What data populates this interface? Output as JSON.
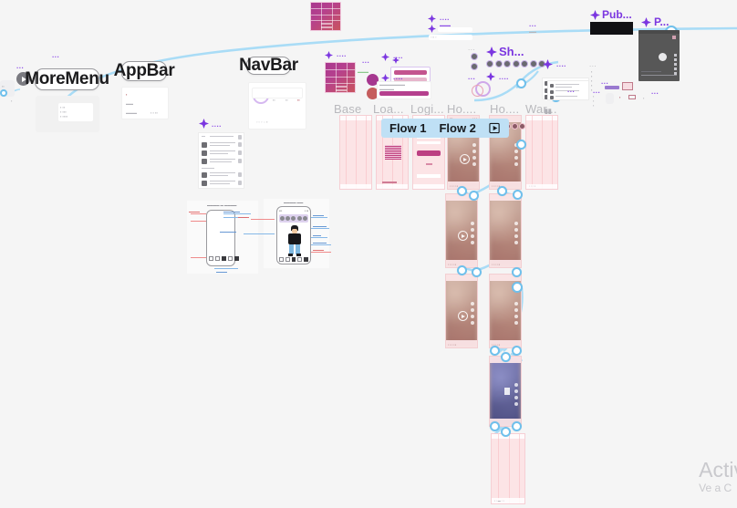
{
  "app": {
    "kind": "design-canvas",
    "background": "#f5f5f5"
  },
  "component_pills": [
    {
      "id": "more-menu",
      "label": "MoreMenu"
    },
    {
      "id": "app-bar",
      "label": "AppBar"
    },
    {
      "id": "nav-bar",
      "label": "NavBar"
    }
  ],
  "frame_labels": [
    {
      "id": "base",
      "text": "Base"
    },
    {
      "id": "load",
      "text": "Loa..."
    },
    {
      "id": "login",
      "text": "Logi..."
    },
    {
      "id": "home1",
      "text": "Ho...."
    },
    {
      "id": "home2",
      "text": "Ho...."
    },
    {
      "id": "warn",
      "text": "War..."
    }
  ],
  "component_labels": [
    {
      "id": "share",
      "text": "Sh...",
      "icon": "component-diamond-icon"
    },
    {
      "id": "publish",
      "text": "Pub...",
      "icon": "component-diamond-icon"
    },
    {
      "id": "player",
      "text": "P...",
      "icon": "component-diamond-icon"
    }
  ],
  "selection_overlay": {
    "tabs": [
      {
        "id": "flow-1",
        "label": "Flow 1"
      },
      {
        "id": "flow-2",
        "label": "Flow 2"
      }
    ],
    "icon": "present-flow-icon",
    "background": "#bfe0f5"
  },
  "micro_labels": [
    "...",
    "....",
    "....",
    "...",
    "....",
    "...",
    "....",
    "...",
    "...",
    "....",
    "...",
    "....",
    "...",
    "....",
    "...",
    "...."
  ],
  "watermark": {
    "line1": "Activ",
    "line2": "Ve a C"
  },
  "colors": {
    "canvas": "#f5f5f5",
    "component_purple": "#7b36e0",
    "connector_blue": "#6fc0ec",
    "selection_blue": "#bfe0f5",
    "frame_label_grey": "#b9b9bd",
    "magenta_start": "#a8378f",
    "magenta_end": "#c9545f",
    "pink_screen": "#fce4e6"
  }
}
